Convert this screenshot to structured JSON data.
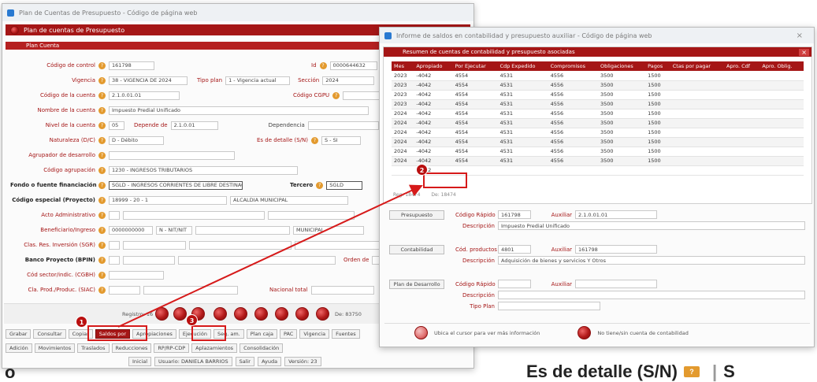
{
  "main_window": {
    "title": "Plan de Cuentas de Presupuesto - Código de página web",
    "header": "Plan de cuentas de Presupuesto",
    "section": "Plan Cuenta",
    "fields": {
      "codigo_control": {
        "label": "Código de control",
        "value": "161798"
      },
      "id": {
        "label": "Id",
        "value": "0000644632"
      },
      "vigencia": {
        "label": "Vigencia",
        "value": "38 - VIGENCIA DE 2024"
      },
      "tipo_plan": {
        "label": "Tipo plan",
        "value": "1 - Vigencia actual"
      },
      "seccion": {
        "label": "Sección",
        "value": "2024"
      },
      "codigo_cuenta": {
        "label": "Código de la cuenta",
        "value": "2.1.0.01.01"
      },
      "codigo_cgpu": {
        "label": "Código CGPU",
        "value": ""
      },
      "nombre_cuenta": {
        "label": "Nombre de la cuenta",
        "value": "Impuesto Predial Unificado"
      },
      "nivel_cuenta": {
        "label": "Nivel de la cuenta",
        "value": "05"
      },
      "depende_de": {
        "label": "Depende de",
        "value": "2.1.0.01"
      },
      "dependencia": {
        "label": "Dependencia",
        "value": ""
      },
      "naturaleza": {
        "label": "Naturaleza (D/C)",
        "value": "D - Débito"
      },
      "es_detalle": {
        "label": "Es de detalle (S/N)",
        "value": "S - SI"
      },
      "agrupador": {
        "label": "Agrupador de desarrollo",
        "value": ""
      },
      "codigo_agrupacion": {
        "label": "Código agrupación",
        "value": "1230 - INGRESOS TRIBUTARIOS"
      },
      "fondo_fuente": {
        "label": "Fondo o fuente financiación",
        "value": "SGLD - INGRESOS CORRIENTES DE LIBRE DESTINACION"
      },
      "tercero": {
        "label": "Tercero",
        "value": "SGLD"
      },
      "codigo_especial": {
        "label": "Código especial (Proyecto)",
        "value": "18999 - 20 - 1"
      },
      "codigo_especial_desc": {
        "label": "",
        "value": "ALCALDIA MUNICIPAL"
      },
      "acto_administrativo": {
        "label": "Acto Administrativo",
        "value": ""
      },
      "beneficiario": {
        "label": "Beneficiario/Ingreso",
        "value": "0000000000"
      },
      "beneficiario_tipo": {
        "label": "",
        "value": "N - NIT/NIT"
      },
      "beneficiario_nombre": {
        "label": "",
        "value": "MUNICIPAL"
      },
      "clas_inversion": {
        "label": "Clas. Res. Inversión (SGR)",
        "value": ""
      },
      "banco_proyecto": {
        "label": "Banco Proyecto (BPIN)",
        "value": ""
      },
      "orden_de": {
        "label": "Orden de",
        "value": ""
      },
      "cod_sector": {
        "label": "Cód sector/indic. (CGBH)",
        "value": ""
      },
      "clas_prod": {
        "label": "Cla. Prod./Produc. (SIAC)",
        "value": ""
      },
      "nacional_total": {
        "label": "Nacional total",
        "value": ""
      }
    },
    "pager_label": "Registro: 16",
    "pager_label_right": "De: 83750",
    "toolbar": [
      "Grabar",
      "Consultar",
      "Copiar",
      "Saldos por",
      "Apropiaciones",
      "Ejecución",
      "Seg. am.",
      "Plan caja",
      "PAC",
      "Vigencia",
      "Fuentes"
    ],
    "highlight_button": "Saldos por",
    "highlight_button2": "Ejecución",
    "bottom_tabs": [
      "Adición",
      "Movimientos",
      "Traslados",
      "Reducciones",
      "RP/RP-CDP",
      "Aplazamientos",
      "Consolidación"
    ],
    "status_strip": [
      "Inicial",
      "Usuario: DANIELA BARRIOS",
      "Salir",
      "Ayuda",
      "Versión: 23"
    ],
    "big_label": "Es de detalle (S/N)",
    "big_label_suffix": "S",
    "big_label_left": "o"
  },
  "popup_window": {
    "title": "Informe de saldos en contabilidad y presupuesto auxiliar - Código de página web",
    "header": "Resumen de cuentas de contabilidad y presupuesto asociadas",
    "columns": [
      "Mes",
      "Apropiado",
      "Por Ejecutar",
      "Cdp Expedido",
      "Compromisos",
      "Obligaciones",
      "Pagos",
      "Ctas por pagar",
      "Apro. Cdf",
      "Apro. Oblig."
    ],
    "rows": [
      [
        "2023",
        "-4042",
        "4554",
        "4531",
        "4556",
        "3500",
        "1500",
        "",
        "",
        ""
      ],
      [
        "2023",
        "-4042",
        "4554",
        "4531",
        "4556",
        "3500",
        "1500",
        "",
        "",
        ""
      ],
      [
        "2023",
        "-4042",
        "4554",
        "4531",
        "4556",
        "3500",
        "1500",
        "",
        "",
        ""
      ],
      [
        "2023",
        "-4042",
        "4554",
        "4531",
        "4556",
        "3500",
        "1500",
        "",
        "",
        ""
      ],
      [
        "2024",
        "-4042",
        "4554",
        "4531",
        "4556",
        "3500",
        "1500",
        "",
        "",
        ""
      ],
      [
        "2024",
        "-4042",
        "4554",
        "4531",
        "4556",
        "3500",
        "1500",
        "",
        "",
        ""
      ],
      [
        "2024",
        "-4042",
        "4554",
        "4531",
        "4556",
        "3500",
        "1500",
        "",
        "",
        ""
      ],
      [
        "2024",
        "-4042",
        "4554",
        "4531",
        "4556",
        "3500",
        "1500",
        "",
        "",
        ""
      ],
      [
        "2024",
        "-4042",
        "4554",
        "4531",
        "4556",
        "3500",
        "1500",
        "",
        "",
        ""
      ],
      [
        "2024",
        "-4042",
        "4554",
        "4531",
        "4556",
        "3500",
        "1500",
        "",
        "",
        ""
      ]
    ],
    "total_row_value": "-4042",
    "footer_left": "Reg: 18474",
    "footer_right": "De: 18474",
    "groups": [
      {
        "button": "Presupuesto",
        "code_label": "Código Rápido",
        "code": "161798",
        "aux_label": "Auxiliar",
        "aux": "2.1.0.01.01",
        "desc_label": "Descripción",
        "desc": "Impuesto Predial Unificado"
      },
      {
        "button": "Contabilidad",
        "code_label": "Cód. productos",
        "code": "4801",
        "aux_label": "Auxiliar",
        "aux": "161798",
        "desc_label": "Descripción",
        "desc": "Adquisición de bienes y servicios Y Otros"
      },
      {
        "button": "Plan de Desarrollo",
        "code_label": "Código Rápido",
        "code": "",
        "aux_label": "Auxiliar",
        "aux": "",
        "desc_label": "Descripción",
        "desc": "",
        "type_label": "Tipo Plan",
        "type": ""
      }
    ],
    "legend1": "Ubica el cursor para ver más información",
    "legend2": "No tiene/sin cuenta de contabilidad"
  },
  "annotations": {
    "badge1": "1",
    "badge2": "2",
    "badge3": "3"
  },
  "colors": {
    "accent": "#a51616",
    "highlight": "#d61a1a",
    "help": "#e39a2e"
  }
}
